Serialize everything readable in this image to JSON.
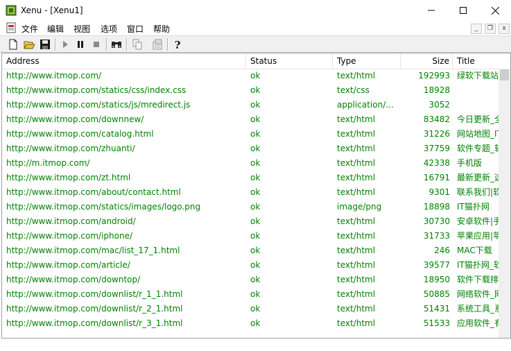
{
  "window": {
    "title": "Xenu - [Xenu1]",
    "minimize_glyph": "—",
    "maximize_glyph": "☐",
    "close_glyph": "✕"
  },
  "menu": {
    "items": [
      "文件",
      "编辑",
      "视图",
      "选项",
      "窗口",
      "帮助"
    ],
    "mdi_minimize": "_",
    "mdi_restore": "❐",
    "mdi_close": "x"
  },
  "toolbar": {
    "buttons": [
      "new-icon",
      "open-icon",
      "save-icon",
      "play-icon",
      "pause-icon",
      "stop-icon",
      "find-icon",
      "copy-icon",
      "properties-icon",
      "help-icon"
    ]
  },
  "table": {
    "columns": [
      "Address",
      "Status",
      "Type",
      "Size",
      "Title"
    ],
    "rows": [
      {
        "address": "http://www.itmop.com/",
        "status": "ok",
        "type": "text/html",
        "size": "192993",
        "title": "绿软下载站"
      },
      {
        "address": "http://www.itmop.com/statics/css/index.css",
        "status": "ok",
        "type": "text/css",
        "size": "18928",
        "title": ""
      },
      {
        "address": "http://www.itmop.com/statics/js/mredirect.js",
        "status": "ok",
        "type": "application/...",
        "size": "3052",
        "title": ""
      },
      {
        "address": "http://www.itmop.com/downnew/",
        "status": "ok",
        "type": "text/html",
        "size": "83482",
        "title": "今日更新_全"
      },
      {
        "address": "http://www.itmop.com/catalog.html",
        "status": "ok",
        "type": "text/html",
        "size": "31226",
        "title": "网站地图_IT"
      },
      {
        "address": "http://www.itmop.com/zhuanti/",
        "status": "ok",
        "type": "text/html",
        "size": "37759",
        "title": "软件专题_软"
      },
      {
        "address": "http://m.itmop.com/",
        "status": "ok",
        "type": "text/html",
        "size": "42338",
        "title": "手机版"
      },
      {
        "address": "http://www.itmop.com/zt.html",
        "status": "ok",
        "type": "text/html",
        "size": "16791",
        "title": "最新更新_这"
      },
      {
        "address": "http://www.itmop.com/about/contact.html",
        "status": "ok",
        "type": "text/html",
        "size": "9301",
        "title": "联系我们|软"
      },
      {
        "address": "http://www.itmop.com/statics/images/logo.png",
        "status": "ok",
        "type": "image/png",
        "size": "18898",
        "title": "IT猫扑网"
      },
      {
        "address": "http://www.itmop.com/android/",
        "status": "ok",
        "type": "text/html",
        "size": "30730",
        "title": "安卓软件|手"
      },
      {
        "address": "http://www.itmop.com/iphone/",
        "status": "ok",
        "type": "text/html",
        "size": "31733",
        "title": "苹果应用|苹"
      },
      {
        "address": "http://www.itmop.com/mac/list_17_1.html",
        "status": "ok",
        "type": "text/html",
        "size": "246",
        "title": "MAC下载"
      },
      {
        "address": "http://www.itmop.com/article/",
        "status": "ok",
        "type": "text/html",
        "size": "39577",
        "title": "IT猫扑网_软"
      },
      {
        "address": "http://www.itmop.com/downtop/",
        "status": "ok",
        "type": "text/html",
        "size": "18950",
        "title": "软件下载排"
      },
      {
        "address": "http://www.itmop.com/downlist/r_1_1.html",
        "status": "ok",
        "type": "text/html",
        "size": "50885",
        "title": "网络软件_网"
      },
      {
        "address": "http://www.itmop.com/downlist/r_2_1.html",
        "status": "ok",
        "type": "text/html",
        "size": "51431",
        "title": "系统工具_系"
      },
      {
        "address": "http://www.itmop.com/downlist/r_3_1.html",
        "status": "ok",
        "type": "text/html",
        "size": "51533",
        "title": "应用软件_有"
      }
    ]
  },
  "colors": {
    "link_green": "#008000"
  }
}
